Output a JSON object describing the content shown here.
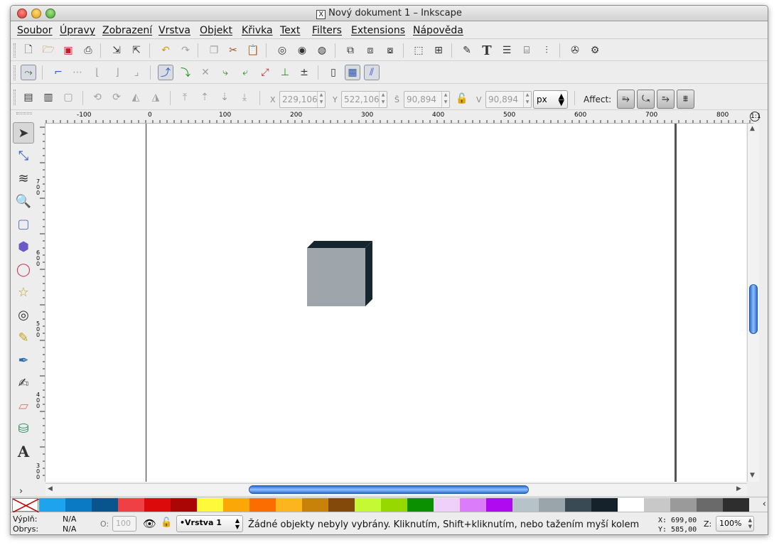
{
  "window": {
    "title": "Nový dokument 1 – Inkscape",
    "title_icon": "X"
  },
  "menu": [
    "Soubor",
    "Úpravy",
    "Zobrazení",
    "Vrstva",
    "Objekt",
    "Křivka",
    "Text",
    "Filters",
    "Extensions",
    "Nápověda"
  ],
  "toolbar_main": {
    "icons": [
      "new-document-icon",
      "open-icon",
      "save-icon",
      "print-icon",
      "import-icon",
      "export-icon",
      "undo-icon",
      "redo-icon",
      "duplicate-icon",
      "cut-icon",
      "paste-icon",
      "zoom-selection-icon",
      "zoom-drawing-icon",
      "zoom-page-icon",
      "group-icon",
      "ungroup-icon",
      "clone-icon",
      "transform-icon",
      "align-distribute-icon",
      "fill-stroke-icon",
      "text-font-icon",
      "layers-icon",
      "xml-editor-icon",
      "align-icon",
      "preferences-icon",
      "document-properties-icon"
    ]
  },
  "toolbar_snap": {
    "icons": [
      "snap-toggle-icon",
      "snap-bbox-icon",
      "snap-bbox-edge-icon",
      "snap-bbox-corner-icon",
      "snap-midpoint-icon",
      "snap-center-icon",
      "snap-nodes-icon",
      "snap-path-icon",
      "snap-intersection-icon",
      "snap-smooth-icon",
      "snap-cusp-icon",
      "snap-midpoint-node-icon",
      "snap-object-center-icon",
      "snap-page-icon",
      "snap-grid-icon",
      "snap-guide-icon"
    ]
  },
  "toolbar_select": {
    "x_label": "X",
    "x_value": "229,106",
    "y_label": "Y",
    "y_value": "522,106",
    "w_label": "Š",
    "w_value": "90,894",
    "h_label": "V",
    "h_value": "90,894",
    "unit": "px",
    "affect_label": "Affect:"
  },
  "ruler": {
    "h_labels": [
      "-100",
      "0",
      "100",
      "200",
      "300",
      "400",
      "500",
      "600",
      "700",
      "800"
    ],
    "v_labels": [
      "700",
      "600",
      "500",
      "400",
      "300"
    ]
  },
  "tools": [
    "selector-arrow-icon",
    "node-edit-icon",
    "tweak-icon",
    "zoom-icon",
    "rectangle-icon",
    "3d-box-icon",
    "ellipse-icon",
    "star-icon",
    "spiral-icon",
    "pencil-icon",
    "pen-icon",
    "calligraphy-icon",
    "eraser-icon",
    "paint-bucket-icon",
    "text-icon"
  ],
  "palette": {
    "colors": [
      "#1ea4ee",
      "#0a7ac4",
      "#08548c",
      "#ef4046",
      "#dc0a0a",
      "#ab0606",
      "#fef93a",
      "#fba707",
      "#fb6d00",
      "#fcb51c",
      "#c8820a",
      "#83490a",
      "#c4f934",
      "#96d800",
      "#0a9000",
      "#eed0fa",
      "#db7cfa",
      "#b00bf0",
      "#b6c4ca",
      "#9aa5ab",
      "#3a4a55",
      "#16222b",
      "#ffffff",
      "#c8c8c8",
      "#9a9a9a",
      "#6a6a6a",
      "#2e2e2e"
    ]
  },
  "status": {
    "fill_label": "Výplň:",
    "fill_value": "N/A",
    "stroke_label": "Obrys:",
    "stroke_value": "N/A",
    "opacity_label": "O:",
    "opacity_value": "100",
    "layer": "•Vrstva 1",
    "message": "Žádné objekty nebyly vybrány. Kliknutím, Shift+kliknutím, nebo tažením myší kolem",
    "x_coord": "X:  699,00",
    "y_coord": "Y:  585,00",
    "zoom_label": "Z:",
    "zoom_value": "100%"
  },
  "canvas": {
    "cube_front_color": "#9ea6ab",
    "cube_dark_color": "#16262e"
  }
}
